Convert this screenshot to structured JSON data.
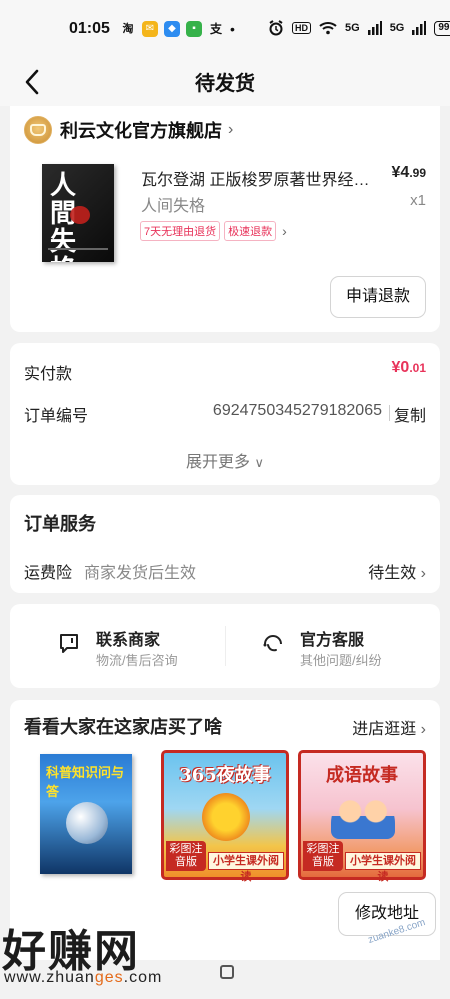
{
  "status_bar": {
    "time": "01:05",
    "apps": [
      {
        "icon": "taobao-icon",
        "glyph": "淘",
        "color": "#111111"
      },
      {
        "icon": "mail-icon",
        "glyph": "✉",
        "color": "#f4b51b"
      },
      {
        "icon": "app-blue-icon",
        "glyph": "◆",
        "color": "#2d8cf0"
      },
      {
        "icon": "message-icon",
        "glyph": "▪",
        "color": "#36b24a"
      },
      {
        "icon": "alipay-icon",
        "glyph": "支",
        "color": "#111111"
      }
    ],
    "dot": "•",
    "hd_label": "HD",
    "signal1": "5G",
    "signal2": "5G",
    "battery": "99"
  },
  "header": {
    "title": "待发货"
  },
  "store": {
    "name": "利云文化官方旗舰店",
    "product": {
      "title": "瓦尔登湖 正版梭罗原著世界经典名著",
      "price_main": "¥4",
      "price_decimal": ".99",
      "spec": "人间失格",
      "qty": "x1",
      "cover_text": "人間失格",
      "tags": [
        "7天无理由退货",
        "极速退款"
      ]
    },
    "refund_button": "申请退款"
  },
  "payment": {
    "paid_label": "实付款",
    "paid_main": "¥0",
    "paid_decimal": ".01",
    "order_label": "订单编号",
    "order_number": "6924750345279182065",
    "copy_label": "复制",
    "expand_label": "展开更多"
  },
  "service": {
    "title": "订单服务",
    "row_label": "运费险",
    "row_desc": "商家发货后生效",
    "row_status": "待生效"
  },
  "contact": {
    "merchant_title": "联系商家",
    "merchant_sub": "物流/售后咨询",
    "service_title": "官方客服",
    "service_sub": "其他问题/纠纷"
  },
  "recommend": {
    "title": "看看大家在这家店买了啥",
    "link": "进店逛逛",
    "books": [
      {
        "title": "科普知识问与答"
      },
      {
        "title": "365夜故事",
        "badge": "彩图注音版",
        "strip": "小学生课外阅读"
      },
      {
        "title": "成语故事",
        "badge": "彩图注音版",
        "strip": "小学生课外阅读"
      }
    ]
  },
  "bottom": {
    "address_button": "修改地址",
    "watermark": "好赚网",
    "watermark_url_pre": "www.zhuan",
    "watermark_url_mid": "ges",
    "watermark_url_post": ".com",
    "watermark_right": "zuanke8.com"
  }
}
